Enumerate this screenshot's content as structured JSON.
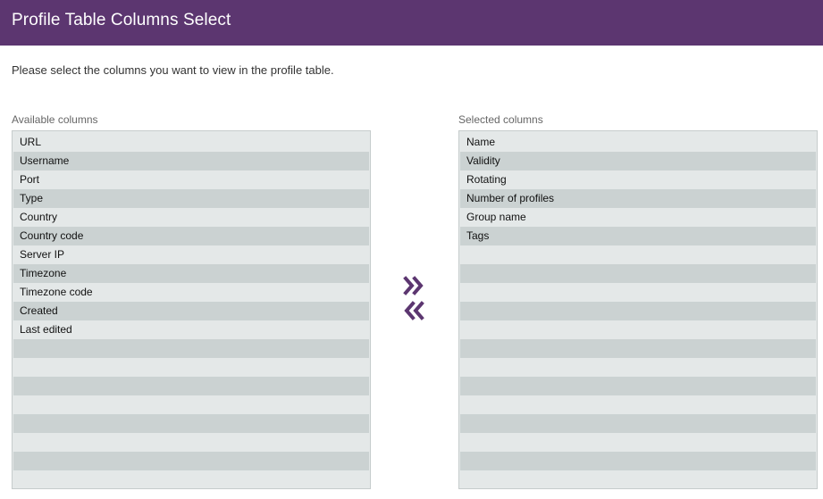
{
  "header": {
    "title": "Profile Table Columns Select"
  },
  "instructions": "Please select the columns you want to view in the profile table.",
  "available": {
    "label": "Available columns",
    "items": [
      "URL",
      "Username",
      "Port",
      "Type",
      "Country",
      "Country code",
      "Server IP",
      "Timezone",
      "Timezone code",
      "Created",
      "Last edited"
    ]
  },
  "selected": {
    "label": "Selected columns",
    "items": [
      "Name",
      "Validity",
      "Rotating",
      "Number of profiles",
      "Group name",
      "Tags"
    ]
  },
  "controls": {
    "add_icon": "double-chevron-right-icon",
    "remove_icon": "double-chevron-left-icon"
  },
  "colors": {
    "header_bg": "#5c3670",
    "accent": "#5c3670",
    "row_light": "#e4e8e8",
    "row_dark": "#cbd2d2"
  }
}
